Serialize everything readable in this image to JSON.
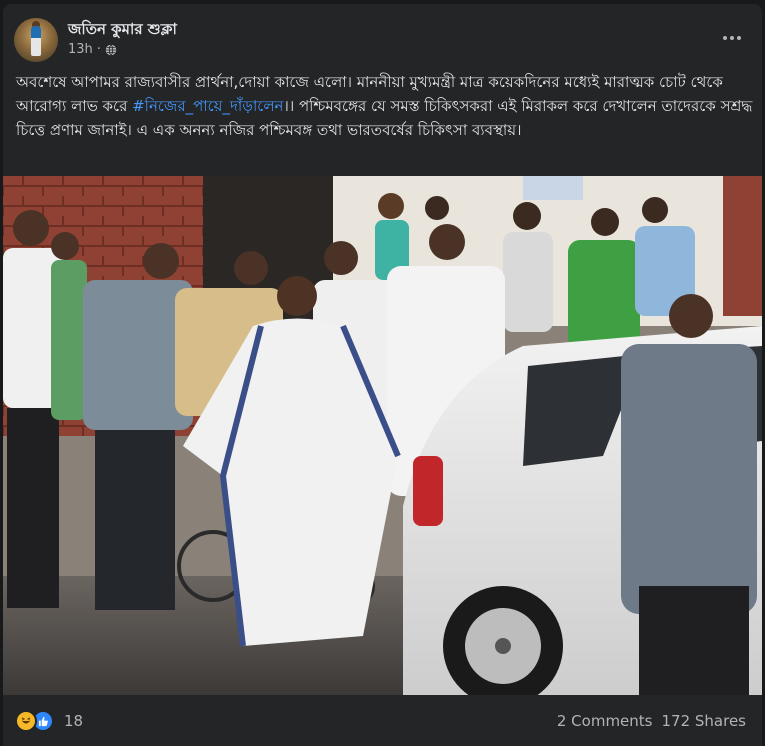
{
  "post": {
    "author": "জতিন কুমার শুক্লা",
    "time": "13h",
    "privacy_icon": "globe-icon",
    "menu_icon": "more-options-icon",
    "text_before": "অবশেষে আপামর রাজ্যবাসীর প্রার্থনা,দোয়া কাজে এলো। মাননীয়া মুখ্যমন্ত্রী মাত্র কয়েকদিনের মধ্যেই মারাত্মক চোট থেকে আরোগ্য লাভ করে ",
    "hashtag": "#নিজের_পায়ে_দাঁড়ালেন",
    "text_after": "।। পশ্চিমবঙ্গের যে সমস্ত চিকিৎসকরা এই মিরাকল করে দেখালেন তাদেরকে সশ্রদ্ধ চিত্তে প্রণাম জানাই। এ এক অনন্য নজির পশ্চিমবঙ্গ তথা ভারতবর্ষের চিকিৎসা ব্যবস্থায়।",
    "photo_icon": "post-photo"
  },
  "footer": {
    "reaction_icons": [
      "haha-reaction-icon",
      "like-reaction-icon"
    ],
    "reaction_count": "18",
    "comments": "2 Comments",
    "shares": "172 Shares"
  },
  "colors": {
    "background": "#18191a",
    "card": "#242526",
    "text": "#e4e6eb",
    "secondary": "#b0b3b8",
    "link": "#4599ff"
  }
}
